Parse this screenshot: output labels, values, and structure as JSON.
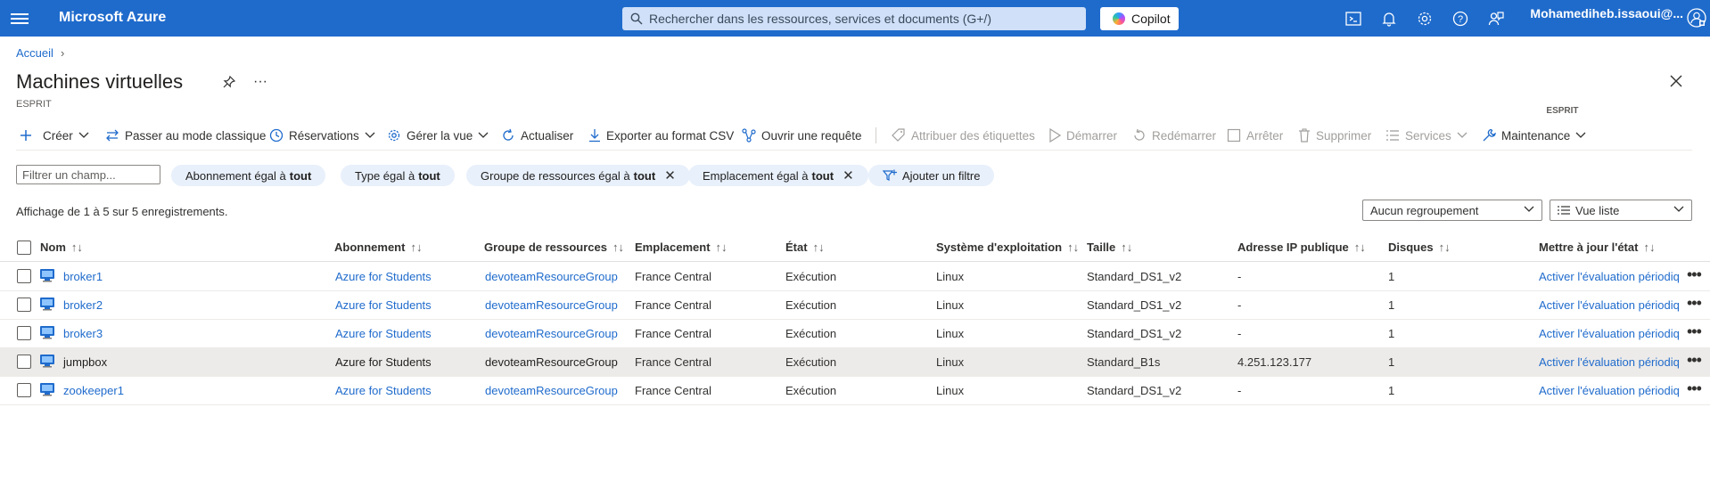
{
  "topbar": {
    "brand": "Microsoft Azure",
    "search_placeholder": "Rechercher dans les ressources, services et documents (G+/)",
    "copilot_label": "Copilot",
    "user_name": "Mohamediheb.issaoui@...",
    "user_org": "ESPRIT",
    "bg_color": "#1f6bcc"
  },
  "header": {
    "breadcrumb": "Accueil",
    "breadcrumb_sep": "›",
    "title": "Machines virtuelles",
    "more": "···",
    "org": "ESPRIT"
  },
  "toolbar": {
    "create": "Créer",
    "classic": "Passer au mode classique",
    "reservations": "Réservations",
    "manage_view": "Gérer la vue",
    "refresh": "Actualiser",
    "export_csv": "Exporter au format CSV",
    "open_query": "Ouvrir une requête",
    "assign_tags": "Attribuer des étiquettes",
    "start": "Démarrer",
    "restart": "Redémarrer",
    "stop": "Arrêter",
    "delete": "Supprimer",
    "services": "Services",
    "maintenance": "Maintenance"
  },
  "filters": {
    "input_placeholder": "Filtrer un champ...",
    "pills": [
      {
        "label": "Abonnement égal à",
        "value": "tout"
      },
      {
        "label": "Type égal à",
        "value": "tout"
      },
      {
        "label": "Groupe de ressources égal à",
        "value": "tout",
        "x": "✕"
      },
      {
        "label": "Emplacement égal à",
        "value": "tout",
        "x": "✕"
      },
      {
        "label": "Ajouter un filtre"
      }
    ]
  },
  "records": {
    "count_text": "Affichage de 1 à 5 sur 5 enregistrements.",
    "grouping": "Aucun regroupement",
    "view": "Vue liste"
  },
  "table": {
    "sort_glyph": "↑↓",
    "columns": [
      "Nom",
      "Abonnement",
      "Groupe de ressources",
      "Emplacement",
      "État",
      "Système d'exploitation",
      "Taille",
      "Adresse IP publique",
      "Disques",
      "Mettre à jour l'état"
    ],
    "rows": [
      {
        "name": "broker1",
        "subscription": "Azure for Students",
        "resource_group": "devoteamResourceGroup",
        "location": "France Central",
        "state": "Exécution",
        "os": "Linux",
        "size": "Standard_DS1_v2",
        "ip": "-",
        "disks": "1",
        "update": "Activer l'évaluation périodique",
        "more": "•••"
      },
      {
        "name": "broker2",
        "subscription": "Azure for Students",
        "resource_group": "devoteamResourceGroup",
        "location": "France Central",
        "state": "Exécution",
        "os": "Linux",
        "size": "Standard_DS1_v2",
        "ip": "-",
        "disks": "1",
        "update": "Activer l'évaluation périodique",
        "more": "•••"
      },
      {
        "name": "broker3",
        "subscription": "Azure for Students",
        "resource_group": "devoteamResourceGroup",
        "location": "France Central",
        "state": "Exécution",
        "os": "Linux",
        "size": "Standard_DS1_v2",
        "ip": "-",
        "disks": "1",
        "update": "Activer l'évaluation périodique",
        "more": "•••"
      },
      {
        "name": "jumpbox",
        "subscription": "Azure for Students",
        "resource_group": "devoteamResourceGroup",
        "location": "France Central",
        "state": "Exécution",
        "os": "Linux",
        "size": "Standard_B1s",
        "ip": "4.251.123.177",
        "disks": "1",
        "update": "Activer l'évaluation périodique",
        "more": "•••"
      },
      {
        "name": "zookeeper1",
        "subscription": "Azure for Students",
        "resource_group": "devoteamResourceGroup",
        "location": "France Central",
        "state": "Exécution",
        "os": "Linux",
        "size": "Standard_DS1_v2",
        "ip": "-",
        "disks": "1",
        "update": "Activer l'évaluation périodique",
        "more": "•••"
      }
    ]
  }
}
